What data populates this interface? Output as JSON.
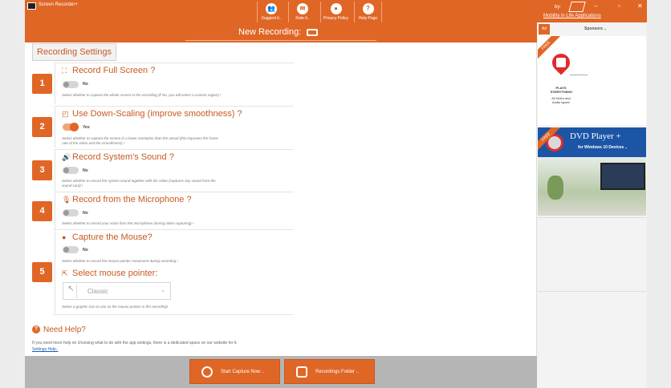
{
  "window": {
    "title": "Screen Recorder+",
    "controls": {
      "minimize": "–",
      "maximize": "▫",
      "close": "✕"
    }
  },
  "toolbar": {
    "buttons": [
      {
        "label": "Suggest it..",
        "icon": "people-icon"
      },
      {
        "label": "Rate it..",
        "icon": "chat-icon"
      },
      {
        "label": "Privacy Policy",
        "icon": "person-icon"
      },
      {
        "label": "Help Page",
        "icon": "question-icon"
      }
    ]
  },
  "publisher": {
    "by": "by:",
    "name": "Mobility in Life Applications"
  },
  "header": {
    "title": "New Recording:",
    "icon": "camera-icon"
  },
  "settings": {
    "tab_label": "Recording Settings",
    "items": [
      {
        "num": "1",
        "icon": "fullscreen-icon",
        "title": "Record Full Screen ?",
        "toggle": "No",
        "on": false,
        "desc": "Select whether to capture the whole screen in the recording (if No, you will select a custom region) !"
      },
      {
        "num": "2",
        "icon": "downscale-icon",
        "title": "Use Down-Scaling (improve smoothness) ?",
        "toggle": "Yes",
        "on": true,
        "desc": "Select whether to capture the screen in a lower resolution than the actual (this improves the frame rate of the video and the smoothness) !"
      },
      {
        "num": "3",
        "icon": "speaker-icon",
        "title": "Record System's Sound ?",
        "toggle": "No",
        "on": false,
        "desc": "Select whether to record the system sound together with the video (captures any sound from the sound card) !"
      },
      {
        "num": "4",
        "icon": "microphone-icon",
        "title": "Record from the Microphone ?",
        "toggle": "No",
        "on": false,
        "desc": "Select whether to record your voice from the microphone (during video capturing) !"
      },
      {
        "num": "5",
        "icon": "mouse-icon",
        "title": "Capture the Mouse?",
        "toggle": "No",
        "on": false,
        "desc": "Select whether to record the mouse pointer movement during recording !"
      }
    ],
    "pointer": {
      "title": "Select mouse pointer:",
      "value": "Classic",
      "desc": "Select a graphic icon to use as the mouse pointer in the recording!"
    }
  },
  "help": {
    "title": "Need Help?",
    "text": "If you need more help on choosing what to do with the app settings, there is a dedicated space on our website for it.",
    "link": "Settings Help.."
  },
  "actions": {
    "start": "Start Capture Now ..",
    "folder": "Recordings Folder .."
  },
  "sponsors": {
    "ad_badge": "Ad",
    "title": "Sponsors ..",
    "ad1": {
      "ribbon": "FREE",
      "text1": "PLAYS EVERYTHING!",
      "text2": "All Video and Audio types!"
    },
    "ad2": {
      "ribbon": "FREE",
      "name": "DVD Player +",
      "subtitle": "for Windows 10 Devices .."
    }
  }
}
